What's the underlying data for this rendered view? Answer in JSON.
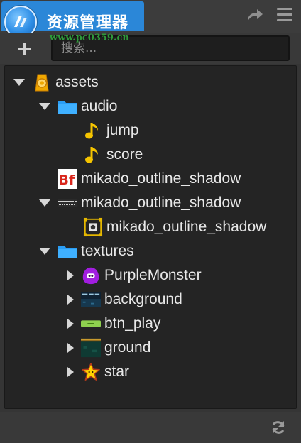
{
  "header": {
    "title": "资源管理器",
    "watermark": "www.pc0359.cn",
    "share_icon": "share-icon",
    "menu_icon": "hamburger-menu-icon"
  },
  "toolbar": {
    "add_icon": "plus-icon",
    "search_placeholder": "搜索..."
  },
  "tree": {
    "items": [
      {
        "label": "assets",
        "icon": "assets-db-icon",
        "expanded": true
      },
      {
        "label": "audio",
        "icon": "folder-icon",
        "expanded": true
      },
      {
        "label": "jump",
        "icon": "music-note-icon"
      },
      {
        "label": "score",
        "icon": "music-note-icon"
      },
      {
        "label": "mikado_outline_shadow",
        "icon": "bitmap-font-icon"
      },
      {
        "label": "mikado_outline_shadow",
        "icon": "font-texture-icon",
        "expanded": true
      },
      {
        "label": "mikado_outline_shadow",
        "icon": "sprite-frame-icon"
      },
      {
        "label": "textures",
        "icon": "folder-icon",
        "expanded": true
      },
      {
        "label": "PurpleMonster",
        "icon": "purple-monster-thumbnail",
        "expanded": false
      },
      {
        "label": "background",
        "icon": "background-thumbnail",
        "expanded": false
      },
      {
        "label": "btn_play",
        "icon": "button-thumbnail",
        "expanded": false
      },
      {
        "label": "ground",
        "icon": "ground-thumbnail",
        "expanded": false
      },
      {
        "label": "star",
        "icon": "star-thumbnail",
        "expanded": false
      }
    ]
  },
  "footer": {
    "refresh_icon": "refresh-icon"
  },
  "colors": {
    "accent": "#2b87d8",
    "folder": "#2a9df4",
    "note": "#f5c400",
    "panel_bg": "#242424",
    "text": "#e8e8e8"
  }
}
